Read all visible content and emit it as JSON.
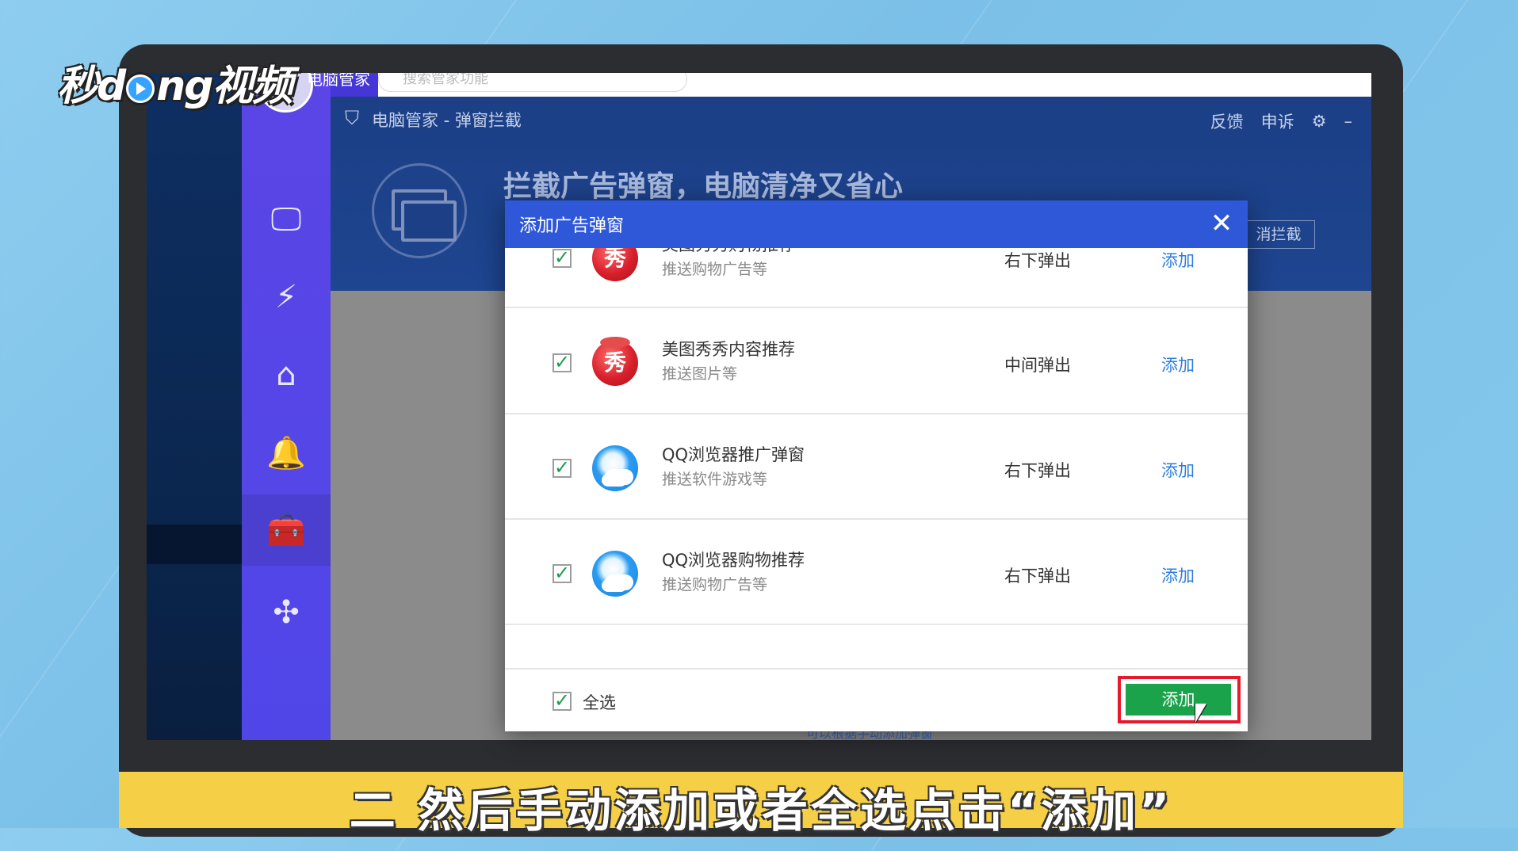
{
  "watermark": {
    "part1": "秒d",
    "part2": "ng视频"
  },
  "window": {
    "top_tab_label": "电脑管家",
    "search_placeholder": "搜索管家功能",
    "header_title": "电脑管家 - 弹窗拦截",
    "header_links": [
      "反馈",
      "申诉"
    ],
    "slogan": "拦截广告弹窗，电脑清净又省心",
    "cancel_label": "消拦截",
    "foot_note": "可以根据手动添加弹窗"
  },
  "sidebar": {
    "items": [
      {
        "icon": "monitor-icon",
        "glyph": "🖵"
      },
      {
        "icon": "speedup-icon",
        "glyph": "⚡"
      },
      {
        "icon": "cleanup-icon",
        "glyph": "⌂"
      },
      {
        "icon": "alert-icon",
        "glyph": "🔔"
      },
      {
        "icon": "toolbox-icon",
        "glyph": "🧰"
      },
      {
        "icon": "apps-icon",
        "glyph": "✣"
      }
    ]
  },
  "dialog": {
    "title": "添加广告弹窗",
    "close_glyph": "✕",
    "rows": [
      {
        "icon": "meitu",
        "name": "美图秀秀购物推荐",
        "desc": "推送购物广告等",
        "pos": "右下弹出",
        "action": "添加",
        "checked": true
      },
      {
        "icon": "meitu",
        "name": "美图秀秀内容推荐",
        "desc": "推送图片等",
        "pos": "中间弹出",
        "action": "添加",
        "checked": true
      },
      {
        "icon": "qq",
        "name": "QQ浏览器推广弹窗",
        "desc": "推送软件游戏等",
        "pos": "右下弹出",
        "action": "添加",
        "checked": true
      },
      {
        "icon": "qq",
        "name": "QQ浏览器购物推荐",
        "desc": "推送购物广告等",
        "pos": "右下弹出",
        "action": "添加",
        "checked": true
      }
    ],
    "meitu_glyph": "秀",
    "check_glyph": "✓",
    "select_all_label": "全选",
    "add_button_label": "添加"
  },
  "subtitle": "二 然后手动添加或者全选点击“添加”",
  "colors": {
    "accent": "#2f58d9",
    "add_button": "#1aa34a",
    "highlight": "#e8192c",
    "link": "#2b7de0",
    "subtitle_bar": "#f5cf45"
  }
}
